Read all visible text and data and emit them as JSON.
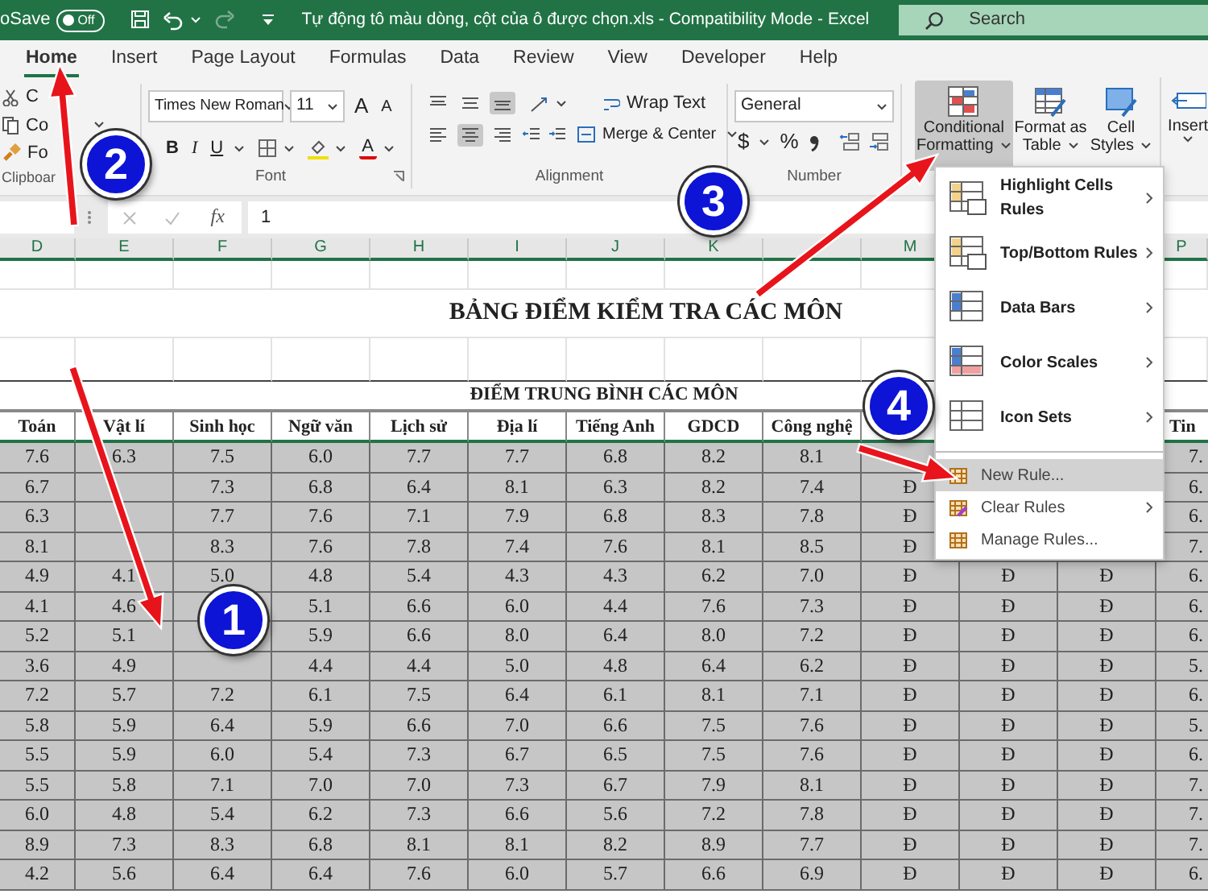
{
  "title_bar": {
    "autosave_label": "oSave",
    "autosave_toggle": {
      "text": "Off",
      "on": false
    },
    "redo": {
      "disabled": true
    },
    "title": "Tự động tô màu dòng, cột của ô được chọn.xls  -  Compatibility Mode  -  Excel",
    "search": {
      "placeholder": "Search"
    }
  },
  "tabs": [
    {
      "label": "Home",
      "selected": true
    },
    {
      "label": "Insert",
      "selected": false
    },
    {
      "label": "Page Layout",
      "selected": false
    },
    {
      "label": "Formulas",
      "selected": false
    },
    {
      "label": "Data",
      "selected": false
    },
    {
      "label": "Review",
      "selected": false
    },
    {
      "label": "View",
      "selected": false
    },
    {
      "label": "Developer",
      "selected": false
    },
    {
      "label": "Help",
      "selected": false
    }
  ],
  "ribbon": {
    "clipboard": {
      "buttons": [
        "C",
        "Co",
        "Fo"
      ],
      "label": "Clipboar"
    },
    "font": {
      "name": "Times New Roman",
      "size": "11",
      "grow": "A",
      "shrink": "A",
      "bold": "B",
      "italic": "I",
      "underline": "U",
      "font_color": "A",
      "label": "Font"
    },
    "alignment": {
      "vertical_buttons": [
        {
          "selected": false
        },
        {
          "selected": false
        },
        {
          "selected": true
        }
      ],
      "horizontal_buttons": [
        {
          "selected": false
        },
        {
          "selected": true
        },
        {
          "selected": false
        }
      ],
      "wrap_text": "Wrap Text",
      "merge": "Merge & Center",
      "label": "Alignment"
    },
    "number": {
      "format": "General",
      "currency": "$",
      "percent": "%",
      "label": "Number"
    },
    "styles": [
      {
        "lines": [
          "Conditional",
          "Formatting"
        ],
        "selected": true
      },
      {
        "lines": [
          "Format as",
          "Table"
        ],
        "selected": false
      },
      {
        "lines": [
          "Cell",
          "Styles"
        ],
        "selected": false
      }
    ],
    "insert": {
      "label": "Insert"
    }
  },
  "formula_bar": {
    "fx": "fx",
    "value": "1"
  },
  "sheet": {
    "column_letters": {
      "D": "D",
      "E": "E",
      "F": "F",
      "G": "G",
      "H": "H",
      "I": "I",
      "J": "J",
      "K": "K",
      "M": "M",
      "P": "P"
    },
    "title": "BẢNG ĐIỂM KIỂM TRA CÁC MÔN",
    "subtitle": "ĐIỂM TRUNG BÌNH CÁC MÔN",
    "headers": {
      "D": "Toán",
      "E": "Vật lí",
      "F": "Sinh học",
      "G": "Ngữ văn",
      "H": "Lịch sử",
      "I": "Địa lí",
      "J": "Tiếng Anh",
      "K": "GDCD",
      "L": "Công nghệ",
      "P": "Tin"
    },
    "rows": [
      {
        "D": "7.6",
        "E": "6.3",
        "F": "7.5",
        "G": "6.0",
        "H": "7.7",
        "I": "7.7",
        "J": "6.8",
        "K": "8.2",
        "L": "8.1",
        "P": "7."
      },
      {
        "D": "6.7",
        "F": "7.3",
        "G": "6.8",
        "H": "6.4",
        "I": "8.1",
        "J": "6.3",
        "K": "8.2",
        "L": "7.4",
        "M": "Đ",
        "P": "6."
      },
      {
        "D": "6.3",
        "F": "7.7",
        "G": "7.6",
        "H": "7.1",
        "I": "7.9",
        "J": "6.8",
        "K": "8.3",
        "L": "7.8",
        "M": "Đ",
        "P": "6."
      },
      {
        "D": "8.1",
        "F": "8.3",
        "G": "7.6",
        "H": "7.8",
        "I": "7.4",
        "J": "7.6",
        "K": "8.1",
        "L": "8.5",
        "M": "Đ",
        "P": "7."
      },
      {
        "D": "4.9",
        "E": "4.1",
        "F": "5.0",
        "G": "4.8",
        "H": "5.4",
        "I": "4.3",
        "J": "4.3",
        "K": "6.2",
        "L": "7.0",
        "M": "Đ",
        "N": "Đ",
        "O": "Đ",
        "P": "6."
      },
      {
        "D": "4.1",
        "E": "4.6",
        "G": "5.1",
        "H": "6.6",
        "I": "6.0",
        "J": "4.4",
        "K": "7.6",
        "L": "7.3",
        "M": "Đ",
        "N": "Đ",
        "O": "Đ",
        "P": "6."
      },
      {
        "D": "5.2",
        "E": "5.1",
        "G": "5.9",
        "H": "6.6",
        "I": "8.0",
        "J": "6.4",
        "K": "8.0",
        "L": "7.2",
        "M": "Đ",
        "N": "Đ",
        "O": "Đ",
        "P": "6."
      },
      {
        "D": "3.6",
        "E": "4.9",
        "G": "4.4",
        "H": "4.4",
        "I": "5.0",
        "J": "4.8",
        "K": "6.4",
        "L": "6.2",
        "M": "Đ",
        "N": "Đ",
        "O": "Đ",
        "P": "5."
      },
      {
        "D": "7.2",
        "E": "5.7",
        "F": "7.2",
        "G": "6.1",
        "H": "7.5",
        "I": "6.4",
        "J": "6.1",
        "K": "8.1",
        "L": "7.1",
        "M": "Đ",
        "N": "Đ",
        "O": "Đ",
        "P": "6."
      },
      {
        "D": "5.8",
        "E": "5.9",
        "F": "6.4",
        "G": "5.9",
        "H": "6.6",
        "I": "7.0",
        "J": "6.6",
        "K": "7.5",
        "L": "7.6",
        "M": "Đ",
        "N": "Đ",
        "O": "Đ",
        "P": "5."
      },
      {
        "D": "5.5",
        "E": "5.9",
        "F": "6.0",
        "G": "5.4",
        "H": "7.3",
        "I": "6.7",
        "J": "6.5",
        "K": "7.5",
        "L": "7.6",
        "M": "Đ",
        "N": "Đ",
        "O": "Đ",
        "P": "6."
      },
      {
        "D": "5.5",
        "E": "5.8",
        "F": "7.1",
        "G": "7.0",
        "H": "7.0",
        "I": "7.3",
        "J": "6.7",
        "K": "7.9",
        "L": "8.1",
        "M": "Đ",
        "N": "Đ",
        "O": "Đ",
        "P": "7."
      },
      {
        "D": "6.0",
        "E": "4.8",
        "F": "5.4",
        "G": "6.2",
        "H": "7.3",
        "I": "6.6",
        "J": "5.6",
        "K": "7.2",
        "L": "7.8",
        "M": "Đ",
        "N": "Đ",
        "O": "Đ",
        "P": "7."
      },
      {
        "D": "8.9",
        "E": "7.3",
        "F": "8.3",
        "G": "6.8",
        "H": "8.1",
        "I": "8.1",
        "J": "8.2",
        "K": "8.9",
        "L": "7.7",
        "M": "Đ",
        "N": "Đ",
        "O": "Đ",
        "P": "7."
      },
      {
        "D": "4.2",
        "E": "5.6",
        "F": "6.4",
        "G": "6.4",
        "H": "7.6",
        "I": "6.0",
        "J": "5.7",
        "K": "6.6",
        "L": "6.9",
        "M": "Đ",
        "N": "Đ",
        "O": "Đ",
        "P": "6."
      }
    ]
  },
  "menu": {
    "items": [
      {
        "kind": "large",
        "label": "Highlight Cells Rules",
        "submenu": true,
        "selected": false
      },
      {
        "kind": "large",
        "label": "Top/Bottom Rules",
        "submenu": true,
        "selected": false
      },
      {
        "kind": "large",
        "label": "Data Bars",
        "submenu": true,
        "selected": false
      },
      {
        "kind": "large",
        "label": "Color Scales",
        "submenu": true,
        "selected": false
      },
      {
        "kind": "large",
        "label": "Icon Sets",
        "submenu": true,
        "selected": false
      },
      {
        "kind": "small",
        "label": "New Rule...",
        "submenu": false,
        "selected": true
      },
      {
        "kind": "small",
        "label": "Clear Rules",
        "submenu": true,
        "selected": false
      },
      {
        "kind": "small",
        "label": "Manage Rules...",
        "submenu": false,
        "selected": false
      }
    ]
  },
  "annotations": [
    {
      "number": "1"
    },
    {
      "number": "2"
    },
    {
      "number": "3"
    },
    {
      "number": "4"
    }
  ]
}
